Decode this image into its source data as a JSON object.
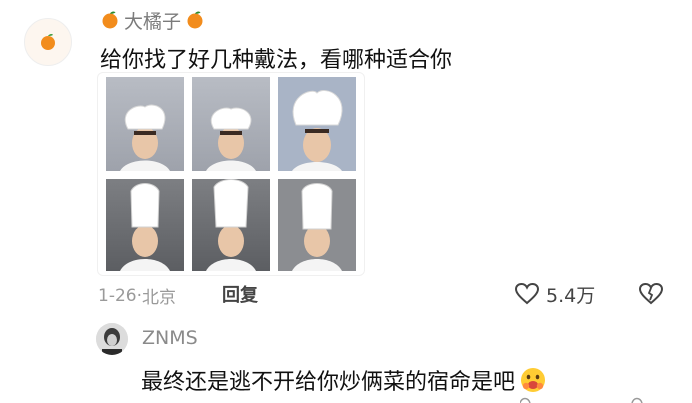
{
  "comment": {
    "username": "大橘子",
    "avatar_icon": "orange-icon",
    "text": "给你找了好几种戴法，看哪种适合你",
    "image_alt": "six photos of a man wearing chef hats",
    "date": "1-26",
    "location": "北京",
    "reply_label": "回复",
    "likes": "5.4万",
    "colors": {
      "orange": "#f28c1c",
      "meta": "#9a9a9a"
    }
  },
  "reply": {
    "username": "ZNMS",
    "text": "最终还是逃不开给你炒俩菜的宿命是吧",
    "emoji_icon": "hug-emoji-icon"
  }
}
